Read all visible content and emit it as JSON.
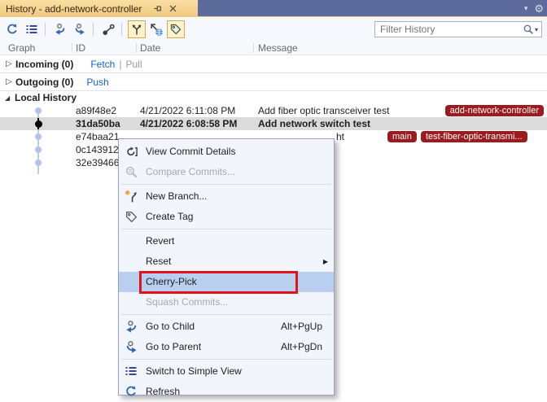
{
  "window": {
    "tab_title": "History - add-network-controller"
  },
  "icons": {
    "chevron_down": "▾",
    "gear": "⚙",
    "collapsed_arrow": "▷",
    "expanded_arrow": "◢",
    "submenu_arrow": "▶",
    "search_caret": "▾"
  },
  "filter": {
    "placeholder": "Filter History"
  },
  "columns": [
    "Graph",
    "ID",
    "Date",
    "Message"
  ],
  "sections": {
    "incoming": {
      "label": "Incoming (0)",
      "fetch": "Fetch",
      "divider": "|",
      "pull": "Pull"
    },
    "outgoing": {
      "label": "Outgoing (0)",
      "push": "Push"
    },
    "local_history": {
      "label": "Local History"
    }
  },
  "commits": [
    {
      "id": "a89f48e2",
      "date": "4/21/2022 6:11:08 PM",
      "message": "Add fiber optic transceiver test",
      "badges": [
        "add-network-controller"
      ],
      "selected": false
    },
    {
      "id": "31da50ba",
      "date": "4/21/2022 6:08:58 PM",
      "message": "Add network switch test",
      "badges": [],
      "selected": true
    },
    {
      "id": "e74baa21",
      "message_visible": "ht",
      "badges": [
        "main",
        "test-fiber-optic-transmi..."
      ],
      "selected": false
    },
    {
      "id": "0c143912",
      "selected": false
    },
    {
      "id": "32e39466",
      "selected": false
    }
  ],
  "context_menu": {
    "items": [
      {
        "label": "View Commit Details"
      },
      {
        "label": "Compare Commits...",
        "disabled": true
      },
      {
        "label": "New Branch..."
      },
      {
        "label": "Create Tag"
      },
      {
        "label": "Revert"
      },
      {
        "label": "Reset",
        "has_submenu": true
      },
      {
        "label": "Cherry-Pick",
        "selected": true,
        "annotated": true
      },
      {
        "label": "Squash Commits...",
        "disabled": true
      },
      {
        "label": "Go to Child",
        "shortcut": "Alt+PgUp"
      },
      {
        "label": "Go to Parent",
        "shortcut": "Alt+PgDn"
      },
      {
        "label": "Switch to Simple View"
      },
      {
        "label": "Refresh"
      }
    ]
  },
  "colors": {
    "titlebar": "#5c6b9c",
    "active_tab_gold": "#f3cc85",
    "badge_red": "#9b1b1e",
    "menu_highlight": "#b9cff0",
    "annotation_red": "#e1141b",
    "link_blue": "#1662c4",
    "graph_blue": "#b0c7e8",
    "selected_row_gray": "#dbdbdb"
  }
}
